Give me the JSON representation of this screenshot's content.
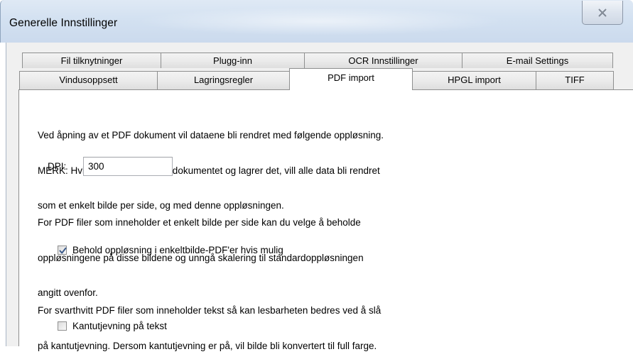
{
  "window": {
    "title": "Generelle Innstillinger",
    "close_icon": "close-x-icon"
  },
  "tabs": {
    "row1": [
      {
        "label": "Fil tilknytninger"
      },
      {
        "label": "Plugg-inn"
      },
      {
        "label": "OCR Innstillinger"
      },
      {
        "label": "E-mail Settings"
      }
    ],
    "row2": [
      {
        "label": "Vindusoppsett"
      },
      {
        "label": "Lagringsregler"
      },
      {
        "label": "PDF import",
        "active": true
      },
      {
        "label": "HPGL import"
      },
      {
        "label": "TIFF"
      }
    ]
  },
  "pdf_import": {
    "intro_lines": [
      "Ved åpning av et PDF dokument vil dataene bli rendret med følgende oppløsning.",
      "MERK: Hvis du gjør endringer i dokumentet og lagrer det, vill alle data bli rendret",
      "som et enkelt bilde per side, og med denne oppløsningen."
    ],
    "dpi_label": "DPI:",
    "dpi_value": "300",
    "keep_resolution_lines": [
      "For PDF filer som inneholder et enkelt bilde per side kan du velge å beholde",
      "oppløsningene på disse bildene og unngå skalering til standardoppløsningen",
      "angitt ovenfor."
    ],
    "keep_resolution_checkbox": {
      "label": "Behold oppløsning i enkeltbilde-PDF'er hvis mulig",
      "checked": true
    },
    "antialias_lines": [
      "For svarthvitt PDF filer som inneholder tekst så kan lesbarheten bedres ved å slå",
      "på kantutjevning. Dersom kantutjevning er på, vil bilde bli konvertert til full farge."
    ],
    "antialias_checkbox": {
      "label": "Kantutjevning på tekst",
      "checked": false
    }
  },
  "colors": {
    "titlebar": "#d3e1f1",
    "dialog_background": "#f0f0f0",
    "panel_background": "#ffffff",
    "checkmark": "#3b5a8a"
  }
}
